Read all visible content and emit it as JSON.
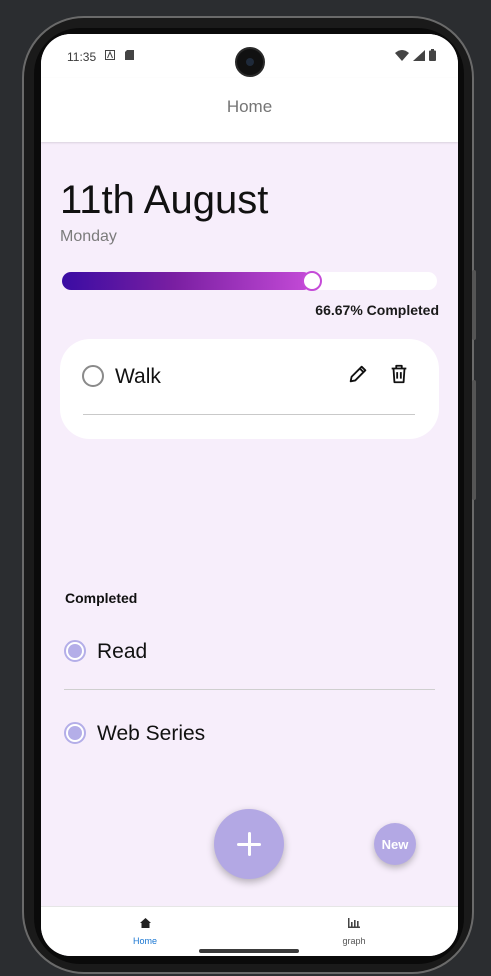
{
  "status_bar": {
    "time": "11:35"
  },
  "top_bar": {
    "title": "Home"
  },
  "header": {
    "date": "11th August",
    "weekday": "Monday"
  },
  "progress": {
    "fraction": 0.6667,
    "label": "66.67% Completed",
    "colors": {
      "start": "#3a0ca3",
      "end": "#c54bd8"
    }
  },
  "pending_tasks": [
    {
      "label": "Walk"
    }
  ],
  "completed": {
    "title": "Completed",
    "items": [
      {
        "label": "Read"
      },
      {
        "label": "Web Series"
      }
    ]
  },
  "fab": {
    "icon": "plus-icon",
    "secondary_label": "New"
  },
  "bottom_nav": {
    "items": [
      {
        "label": "Home",
        "icon": "home-icon",
        "active": true
      },
      {
        "label": "graph",
        "icon": "bar-chart-icon",
        "active": false
      }
    ],
    "active_color": "#1976d2"
  },
  "colors": {
    "background": "#f7eefb",
    "accent": "#b3a8e4"
  }
}
